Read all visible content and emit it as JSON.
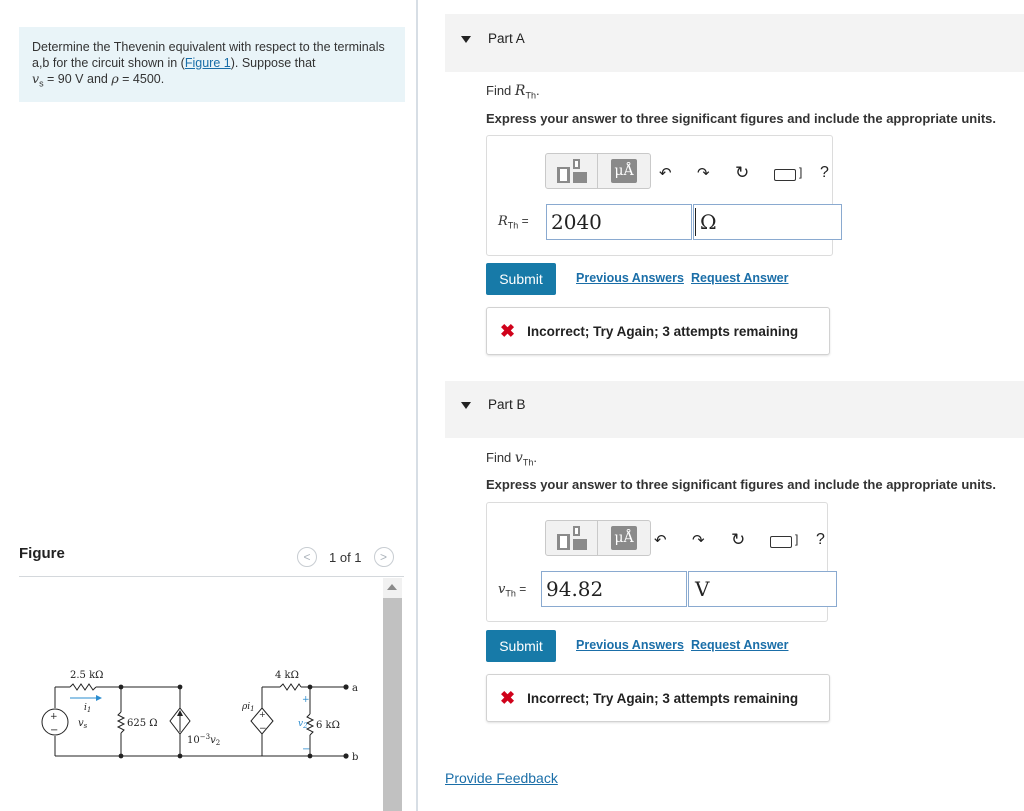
{
  "problem": {
    "text_before_link": "Determine the Thevenin equivalent with respect to the terminals a,b for the circuit shown in (",
    "link_text": "Figure 1",
    "text_after_link": "). Suppose that",
    "vs_symbol": "v",
    "vs_sub": "s",
    "vs_value": " = 90  V and ",
    "rho_symbol": "ρ",
    "rho_value": " = 4500."
  },
  "figure": {
    "title": "Figure",
    "pager_text": "1 of 1",
    "prev_glyph": "<",
    "next_glyph": ">",
    "circuit_labels": {
      "r1": "2.5 kΩ",
      "i1": "i",
      "i1_sub": "1",
      "vs": "v",
      "vs_sub": "s",
      "plus": "+",
      "minus": "−",
      "r2": "625 Ω",
      "cs": "10",
      "cs_exp": "−3",
      "cs_var": "v",
      "cs_var_sub": "2",
      "dep": "ρi",
      "dep_sub": "1",
      "r3": "4 kΩ",
      "node_a": "a",
      "node_b": "b",
      "v2": "v",
      "v2_sub": "2",
      "r4": "6 kΩ"
    }
  },
  "partA": {
    "label": "Part A",
    "find_prefix": "Find ",
    "find_var": "R",
    "find_sub": "Th",
    "find_suffix": ".",
    "instruction": "Express your answer to three significant figures and include the appropriate units.",
    "toolbar": {
      "units_glyph": "μÅ",
      "help": "?"
    },
    "var_name": "R",
    "var_sub": "Th",
    "equals": " =",
    "value": "2040",
    "unit": "Ω",
    "submit": "Submit",
    "previous_answers": "Previous Answers",
    "request_answer": "Request Answer",
    "feedback_icon": "✖",
    "feedback": "Incorrect; Try Again; 3 attempts remaining"
  },
  "partB": {
    "label": "Part B",
    "find_prefix": "Find ",
    "find_var": "v",
    "find_sub": "Th",
    "find_suffix": ".",
    "instruction": "Express your answer to three significant figures and include the appropriate units.",
    "toolbar": {
      "units_glyph": "μÅ",
      "help": "?"
    },
    "var_name": "v",
    "var_sub": "Th",
    "equals": " =",
    "value": "94.82",
    "unit": "V",
    "submit": "Submit",
    "previous_answers": "Previous Answers",
    "request_answer": "Request Answer",
    "feedback_icon": "✖",
    "feedback": "Incorrect; Try Again; 3 attempts remaining"
  },
  "footer": {
    "provide_feedback": "Provide Feedback"
  },
  "colors": {
    "link": "#1a6ea8",
    "submit_bg": "#177aa8",
    "error": "#d0021b",
    "problem_bg": "#e9f4f8",
    "part_header_bg": "#f3f3f3"
  }
}
